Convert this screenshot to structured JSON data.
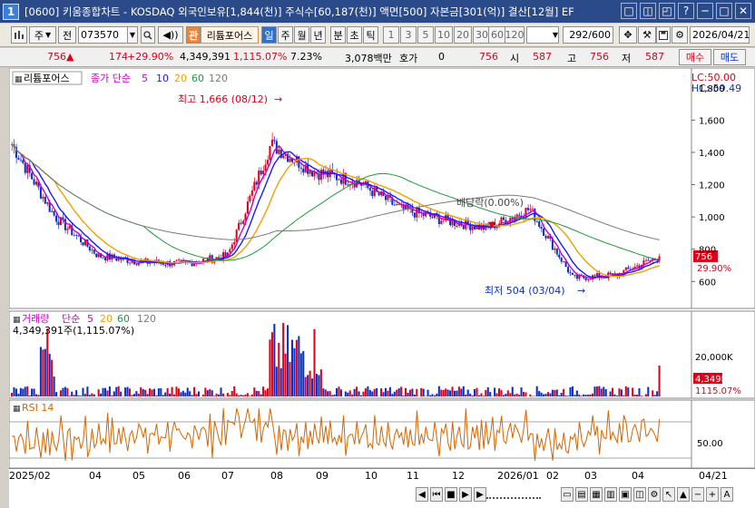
{
  "window": {
    "app_number": "1",
    "title": "[0600] 키움종합차트 - KOSDAQ 외국인보유[1,844(천)] 주식수[60,187(천)] 액면[500] 자본금[301(억)] 결산[12월] EF",
    "buttons": [
      "□",
      "◫",
      "◰",
      "?",
      "─",
      "□",
      "✕"
    ]
  },
  "toolbar": {
    "market_label": "주",
    "prefix_label": "전",
    "code_value": "073570",
    "related_label": "관",
    "stock_name": "리튬포어스",
    "periods": [
      "일",
      "주",
      "월",
      "년",
      "분",
      "초",
      "틱"
    ],
    "selected_period": "일",
    "intervals": [
      "1",
      "3",
      "5",
      "10",
      "20",
      "30",
      "60",
      "120"
    ],
    "count_value": "292",
    "count_total": "/600",
    "date_value": "2026/04/21"
  },
  "quote": {
    "price": "756",
    "change_arrow": "▲",
    "change": "174",
    "change_pct": "+29.90%",
    "volume": "4,349,391",
    "volume_ratio": "1,115.07%",
    "turnover": "7.23%",
    "amount": "3,078백만",
    "hoga_label": "호가",
    "hoga_value": "0",
    "hoga_price": "756",
    "open_label": "시",
    "open": "587",
    "high_label": "고",
    "high": "756",
    "low_label": "저",
    "low": "587",
    "buy_button": "매수",
    "sell_button": "매도"
  },
  "price_pane": {
    "name_label": "리튬포어스",
    "ma_label": "종가 단순",
    "ma_periods": [
      "5",
      "10",
      "20",
      "60",
      "120"
    ],
    "lc": "LC:50.00",
    "hc": "HC:-59.49",
    "high_annotation": "최고 1,666 (08/12)",
    "low_annotation": "최저 504 (03/04)",
    "dividend_annotation": "배당락(0.00%)",
    "current_price_tag": "756",
    "current_pct_tag": "29.90%"
  },
  "volume_pane": {
    "label": "거래량",
    "ma_label": "단순",
    "ma_periods": [
      "5",
      "20",
      "60",
      "120"
    ],
    "value_text": "4,349,391주(1,115.07%)",
    "tag_value": "4,349K",
    "tag_pct": "1115.07%"
  },
  "rsi_pane": {
    "label": "RSI 14",
    "level_label": "50.00"
  },
  "colors": {
    "up": "#e0001a",
    "down": "#0a2fc8",
    "ma5": "#c800c8",
    "ma10": "#1a1aff",
    "ma20": "#f0a000",
    "ma60": "#1f9a3a",
    "ma120": "#7a7a7a",
    "rsi": "#d86400"
  },
  "chart_data": {
    "type": "candlestick",
    "price_axis_ticks": [
      "1,800",
      "1,600",
      "1,400",
      "1,200",
      "1,000",
      "800",
      "600"
    ],
    "volume_axis_ticks": [
      "20,000K"
    ],
    "time_axis_labels": [
      "2025/02",
      "04",
      "05",
      "06",
      "07",
      "08",
      "09",
      "10",
      "11",
      "12",
      "2026/01",
      "02",
      "03",
      "04",
      "04/21"
    ],
    "price_series": {
      "dates": [
        "2025/02",
        "2025/03",
        "2025/04",
        "2025/05",
        "2025/06",
        "2025/07",
        "2025/08",
        "2025/09",
        "2025/10",
        "2025/11",
        "2025/12",
        "2026/01",
        "2026/02",
        "2026/03",
        "2026/04",
        "2026/04/21"
      ],
      "close": [
        1450,
        1000,
        760,
        720,
        710,
        760,
        1450,
        1280,
        1220,
        1050,
        980,
        930,
        1050,
        620,
        640,
        756
      ]
    },
    "high": {
      "value": 1666,
      "date": "08/12"
    },
    "low": {
      "value": 504,
      "date": "03/04"
    },
    "rsi_level": 50
  }
}
